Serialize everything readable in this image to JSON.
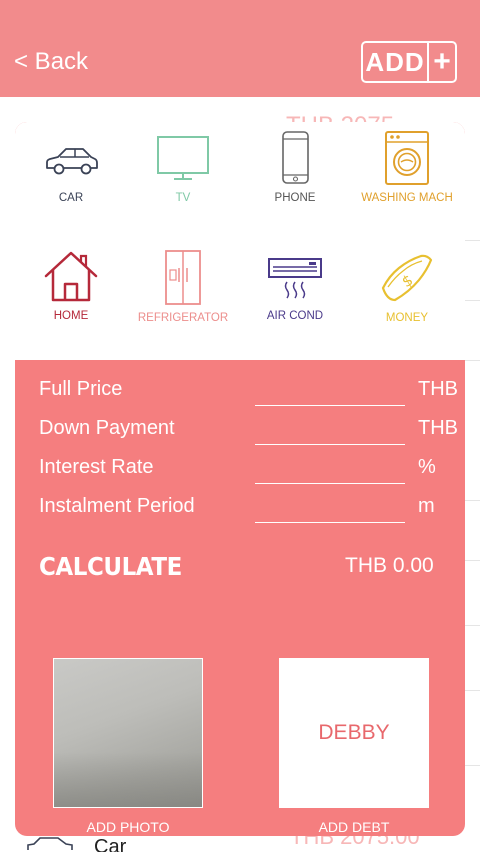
{
  "header": {
    "back_label": "< Back",
    "add_label": "ADD",
    "add_plus": "+"
  },
  "background": {
    "top_amount": "THB 2075",
    "bottom_item_label": "Car",
    "bottom_amount": "THB 2075.00"
  },
  "categories": [
    {
      "label": "CAR",
      "icon": "car-icon",
      "color": "#3a4256"
    },
    {
      "label": "TV",
      "icon": "tv-icon",
      "color": "#7fc9a6"
    },
    {
      "label": "PHONE",
      "icon": "phone-icon",
      "color": "#555555"
    },
    {
      "label": "WASHING MACH",
      "icon": "washing-machine-icon",
      "color": "#e0a02c"
    },
    {
      "label": "HOME",
      "icon": "home-icon",
      "color": "#b5293a"
    },
    {
      "label": "REFRIGERATOR",
      "icon": "refrigerator-icon",
      "color": "#ec8e8c"
    },
    {
      "label": "AIR COND",
      "icon": "air-conditioner-icon",
      "color": "#4a3a8a"
    },
    {
      "label": "MONEY",
      "icon": "money-icon",
      "color": "#e8c030"
    }
  ],
  "form": {
    "fields": [
      {
        "label": "Full Price",
        "value": "",
        "unit": "THB"
      },
      {
        "label": "Down Payment",
        "value": "",
        "unit": "THB"
      },
      {
        "label": "Interest Rate",
        "value": "",
        "unit": "%"
      },
      {
        "label": "Instalment Period",
        "value": "",
        "unit": "m"
      }
    ],
    "calculate_label": "CALCULATE",
    "result": "THB 0.00"
  },
  "actions": {
    "photo_label": "ADD PHOTO",
    "debt_name": "DEBBY",
    "debt_label": "ADD DEBT"
  },
  "colors": {
    "header_bg": "#f28b8c",
    "panel_bg": "#f57e7f",
    "accent_text": "#e8686c"
  }
}
